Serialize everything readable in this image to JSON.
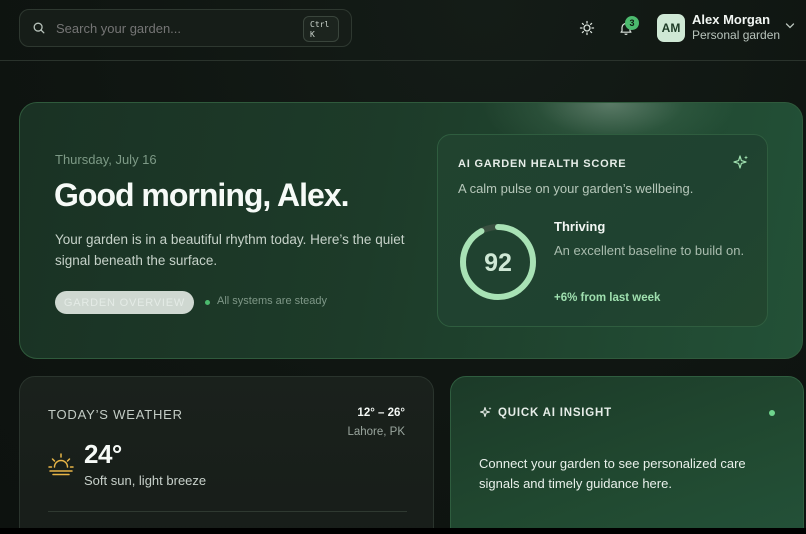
{
  "search": {
    "placeholder": "Search your garden...",
    "shortcut_line1": "Ctrl",
    "shortcut_line2": "K"
  },
  "header": {
    "notifications_count": "3",
    "user": {
      "initials": "AM",
      "name": "Alex Morgan",
      "subtitle": "Personal garden"
    }
  },
  "hero": {
    "date": "Thursday, July 16",
    "greeting": "Good morning, Alex.",
    "description": "Your garden is in a beautiful rhythm today. Here’s the quiet signal beneath the surface.",
    "pill_label": "GARDEN OVERVIEW",
    "status": "All systems are steady"
  },
  "health": {
    "title": "AI GARDEN HEALTH SCORE",
    "subtitle": "A calm pulse on your garden’s wellbeing.",
    "score": "92",
    "score_fraction": 0.92,
    "status": "Thriving",
    "description": "An excellent baseline to build on.",
    "trend": "+6% from last week"
  },
  "weather": {
    "title": "TODAY’S WEATHER",
    "range": "12° – 26°",
    "location": "Lahore, PK",
    "temperature": "24°",
    "condition": "Soft sun, light breeze"
  },
  "insight": {
    "title": "QUICK AI INSIGHT",
    "text": "Connect your garden to see personalized care signals and timely guidance here."
  },
  "colors": {
    "accent": "#4cba6e",
    "ring": "#a8e2b5",
    "card": "#1f4230",
    "background": "#101612"
  }
}
